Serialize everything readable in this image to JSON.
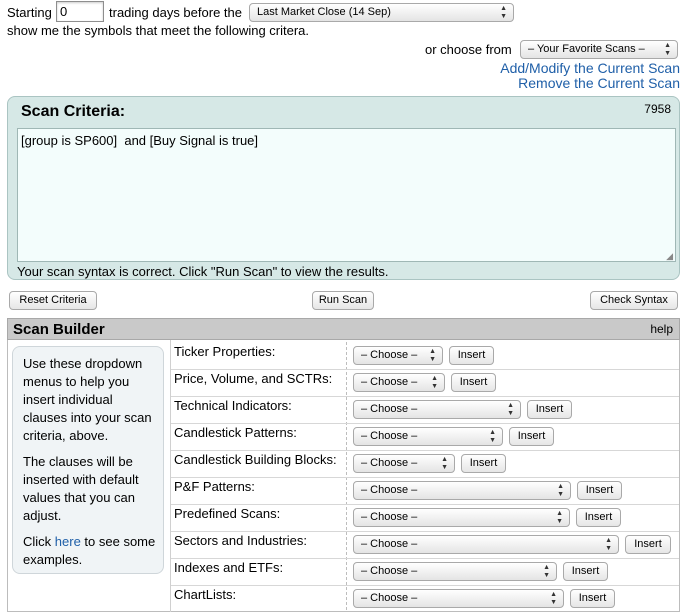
{
  "top": {
    "starting_label": "Starting",
    "days_value": "0",
    "trading_label": "trading days before the",
    "market_select": "Last Market Close (14 Sep)",
    "show_line": "show me the symbols that meet the following critera.",
    "or_choose_label": "or choose from",
    "favorites_select": "– Your Favorite Scans –",
    "add_modify_link": "Add/Modify the Current Scan",
    "remove_link": "Remove the Current Scan"
  },
  "criteria": {
    "title": "Scan Criteria:",
    "count": "7958",
    "text": "[group is SP600]  and [Buy Signal is true]",
    "status": "Your scan syntax is correct. Click \"Run Scan\" to view the results."
  },
  "buttons": {
    "reset": "Reset Criteria",
    "run": "Run Scan",
    "check": "Check Syntax"
  },
  "builder": {
    "title": "Scan Builder",
    "help": "help",
    "help_p1": "Use these dropdown menus to help you insert individual clauses into your scan criteria, above.",
    "help_p2": "The clauses will be inserted with default values that you can adjust.",
    "help_p3_pre": "Click ",
    "help_p3_link": "here",
    "help_p3_post": " to see some examples.",
    "choose_label": "– Choose –",
    "insert_label": "Insert",
    "rows": [
      {
        "label": "Ticker Properties:"
      },
      {
        "label": "Price, Volume, and SCTRs:"
      },
      {
        "label": "Technical Indicators:"
      },
      {
        "label": "Candlestick Patterns:"
      },
      {
        "label": "Candlestick Building Blocks:"
      },
      {
        "label": "P&F Patterns:"
      },
      {
        "label": "Predefined Scans:"
      },
      {
        "label": "Sectors and Industries:"
      },
      {
        "label": "Indexes and ETFs:"
      },
      {
        "label": "ChartLists:"
      }
    ]
  }
}
